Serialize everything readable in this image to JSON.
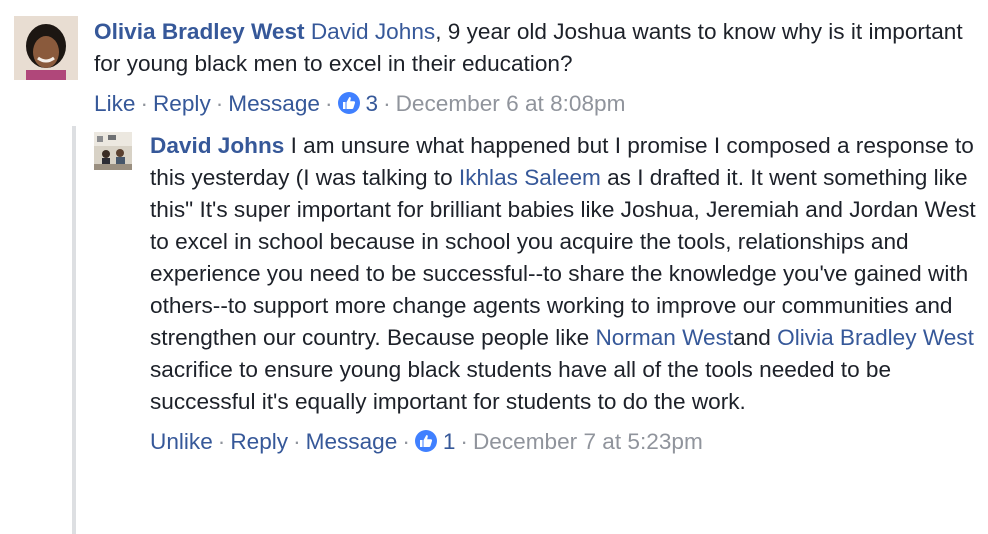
{
  "comment": {
    "author": "Olivia Bradley West",
    "mention": "David Johns",
    "text": ", 9 year old Joshua wants to know why is it important for young black men to excel in their education?",
    "actions": {
      "like": "Like",
      "reply": "Reply",
      "message": "Message",
      "like_count": "3",
      "timestamp": "December 6 at 8:08pm"
    }
  },
  "reply": {
    "author": "David Johns",
    "text_1": " I am unsure what happened but I promise I composed a response to this yesterday (I was talking to ",
    "mention_1": "Ikhlas Saleem",
    "text_2": " as I drafted it. It went something like this\" It's super important for brilliant babies like Joshua, Jeremiah and Jordan West to excel in school because in school you acquire the tools, relationships and experience you need to be successful--to share the knowledge you've gained with others--to support more change agents working to improve our communities and strengthen our country. Because people like ",
    "mention_2": "Norman West",
    "text_3": "and ",
    "mention_3": "Olivia Bradley West",
    "text_4": " sacrifice to ensure young black students have all of the tools needed to be successful it's equally important for students to do the work.",
    "actions": {
      "unlike": "Unlike",
      "reply": "Reply",
      "message": "Message",
      "like_count": "1",
      "timestamp": "December 7 at 5:23pm"
    }
  },
  "colors": {
    "link": "#365899",
    "meta": "#90949c",
    "like_badge": "#4080ff",
    "thread_line": "#dddfe2"
  },
  "icons": {
    "like_badge": "thumbs-up-icon"
  }
}
